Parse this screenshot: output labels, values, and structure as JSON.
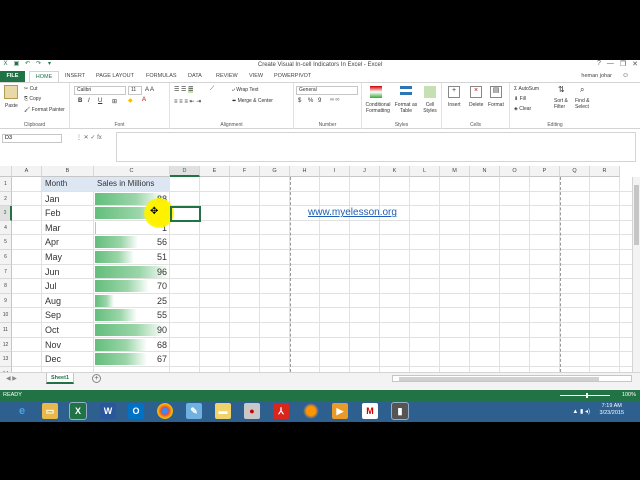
{
  "window": {
    "title": "Create Visual In-cell Indicators In Excel - Excel",
    "minimize": "—",
    "restore": "❐",
    "close": "✕",
    "help": "?"
  },
  "menu": {
    "file": "FILE",
    "tabs": [
      "HOME",
      "INSERT",
      "PAGE LAYOUT",
      "FORMULAS",
      "DATA",
      "REVIEW",
      "VIEW",
      "POWERPIVOT"
    ],
    "user": "heman johar"
  },
  "ribbon": {
    "clipboard": {
      "paste": "Paste",
      "cut": "Cut",
      "copy": "Copy",
      "format_painter": "Format Painter",
      "label": "Clipboard"
    },
    "font": {
      "name": "Calibri",
      "size": "11",
      "bold": "B",
      "italic": "I",
      "underline": "U",
      "label": "Font"
    },
    "alignment": {
      "wrap": "Wrap Text",
      "merge": "Merge & Center",
      "label": "Alignment"
    },
    "number": {
      "format": "General",
      "currency": "$",
      "percent": "%",
      "comma": "9",
      "label": "Number"
    },
    "styles": {
      "conditional": "Conditional Formatting",
      "format_table": "Format as Table",
      "cell_styles": "Cell Styles",
      "label": "Styles"
    },
    "cells": {
      "insert": "Insert",
      "delete": "Delete",
      "format": "Format",
      "label": "Cells"
    },
    "editing": {
      "autosum": "AutoSum",
      "fill": "Fill",
      "clear": "Clear",
      "sort": "Sort & Filter",
      "find": "Find & Select",
      "label": "Editing"
    }
  },
  "formula_bar": {
    "name_box": "D3",
    "fx": "fx",
    "content": ""
  },
  "columns": [
    "A",
    "B",
    "C",
    "D",
    "E",
    "F",
    "G",
    "H",
    "I",
    "J",
    "K",
    "L",
    "M",
    "N",
    "O",
    "P",
    "Q",
    "R"
  ],
  "rows": [
    "1",
    "2",
    "3",
    "4",
    "5",
    "6",
    "7",
    "8",
    "9",
    "10",
    "11",
    "12",
    "13",
    "14"
  ],
  "sheet": {
    "header_month": "Month",
    "header_sales": "Sales in Millions",
    "data": [
      {
        "month": "Jan",
        "sales": 88
      },
      {
        "month": "Feb",
        "sales": 95
      },
      {
        "month": "Mar",
        "sales": 1
      },
      {
        "month": "Apr",
        "sales": 56
      },
      {
        "month": "May",
        "sales": 51
      },
      {
        "month": "Jun",
        "sales": 96
      },
      {
        "month": "Jul",
        "sales": 70
      },
      {
        "month": "Aug",
        "sales": 25
      },
      {
        "month": "Sep",
        "sales": 55
      },
      {
        "month": "Oct",
        "sales": 90
      },
      {
        "month": "Nov",
        "sales": 68
      },
      {
        "month": "Dec",
        "sales": 67
      }
    ],
    "link": "www.myelesson.org",
    "databar_max": 96,
    "databar_color": "#63be7b"
  },
  "sheet_tab": "Sheet1",
  "status": {
    "ready": "READY",
    "zoom": "100%"
  },
  "taskbar": {
    "icons": [
      "ie-icon",
      "explorer-icon",
      "excel-icon",
      "word-icon",
      "outlook-icon",
      "chrome-icon",
      "notepad-icon",
      "folder-icon",
      "paint-icon",
      "acrobat-icon",
      "firefox-icon",
      "media-icon",
      "m-icon",
      "app-icon"
    ],
    "time": "7:19 AM",
    "date": "3/23/2015"
  }
}
